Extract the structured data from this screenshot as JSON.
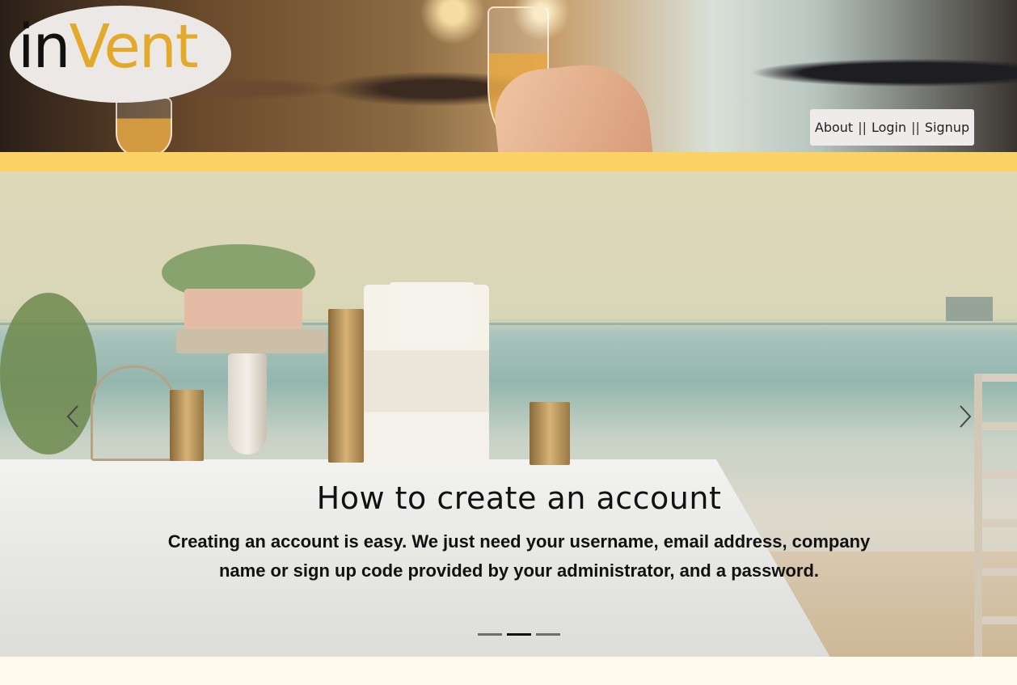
{
  "logo": {
    "part1": "in",
    "part2": "Vent"
  },
  "nav": {
    "about": "About",
    "login": "Login",
    "signup": "Signup",
    "separator": "||"
  },
  "colors": {
    "accent_band": "#fdd264",
    "logo_accent": "#e2a92a",
    "page_bg": "#fff9ee"
  },
  "carousel": {
    "title": "How to create an account",
    "text": "Creating an account is easy. We just need your username, email address, company name or sign up code provided by your administrator, and a password.",
    "indicators": {
      "count": 3,
      "active_index": 1
    },
    "prev_icon": "chevron-left-icon",
    "next_icon": "chevron-right-icon"
  }
}
